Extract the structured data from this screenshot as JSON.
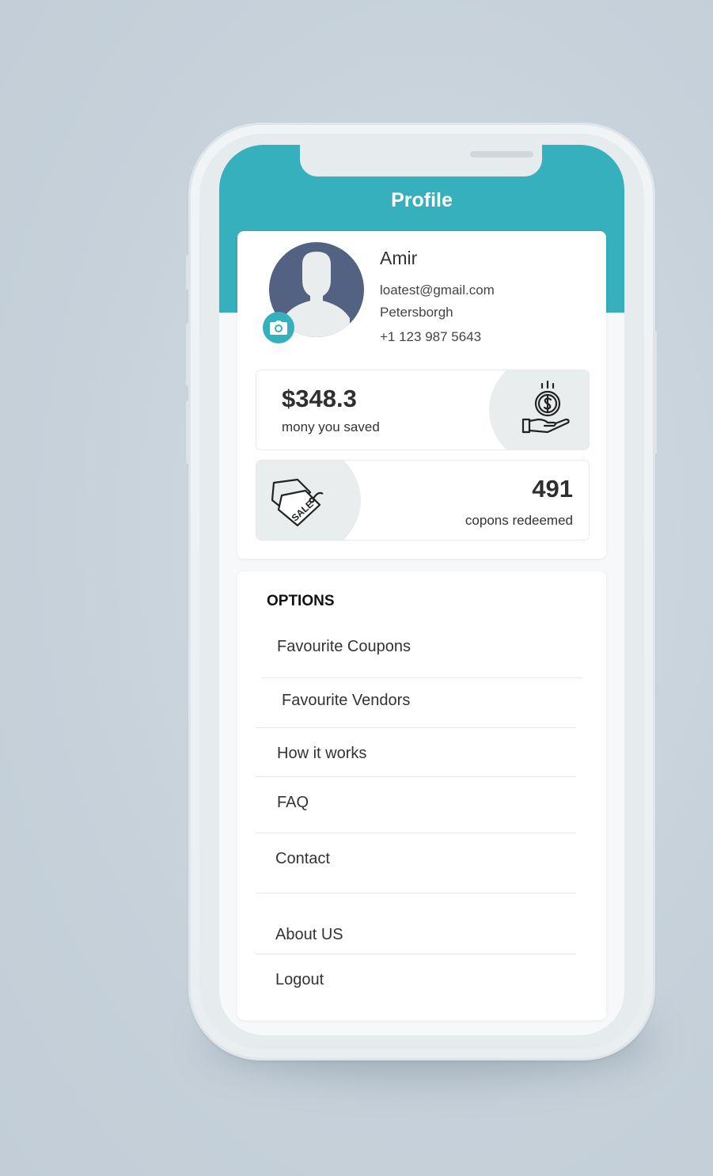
{
  "header": {
    "title": "Profile"
  },
  "user": {
    "name": "Amir",
    "email": "loatest@gmail.com",
    "city": "Petersborgh",
    "phone": "+1 123 987 5643"
  },
  "stats": {
    "saved": {
      "value": "$348.3",
      "label": "mony you saved",
      "icon": "money-hand-icon"
    },
    "redeemed": {
      "value": "491",
      "label": "copons redeemed",
      "icon": "sale-tag-icon"
    }
  },
  "options": {
    "title": "OPTIONS",
    "items": [
      {
        "label": "Favourite Coupons"
      },
      {
        "label": "Favourite Vendors"
      },
      {
        "label": "How it works"
      },
      {
        "label": "FAQ"
      },
      {
        "label": "Contact"
      },
      {
        "label": "About US"
      },
      {
        "label": "Logout"
      }
    ]
  },
  "colors": {
    "accent": "#36b0bc",
    "avatar": "#536283",
    "background": "#c8d3dc"
  }
}
